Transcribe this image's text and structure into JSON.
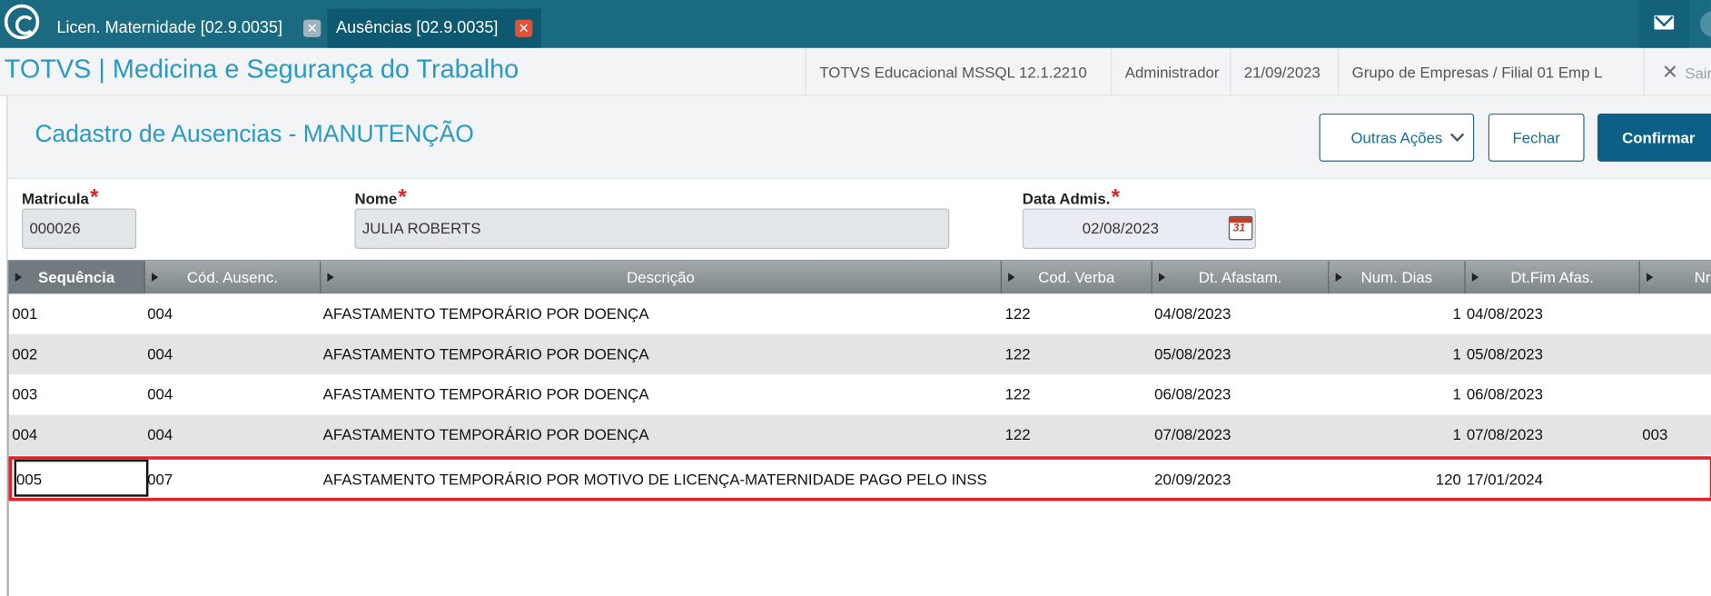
{
  "tabs": [
    {
      "label": "Licen. Maternidade [02.9.0035]",
      "close": "✕"
    },
    {
      "label": "Ausências [02.9.0035]",
      "close": "✕"
    }
  ],
  "header": {
    "title": "TOTVS | Medicina e Segurança do Trabalho",
    "environment": "TOTVS Educacional MSSQL 12.1.2210",
    "user": "Administrador",
    "date": "21/09/2023",
    "company": "Grupo de Empresas / Filial 01 Emp L",
    "exit_label": "Sair",
    "exit_icon": "✕"
  },
  "page": {
    "title": "Cadastro de Ausencias - MANUTENÇÃO",
    "buttons": {
      "outras": "Outras Ações",
      "fechar": "Fechar",
      "confirmar": "Confirmar"
    }
  },
  "form": {
    "matricula": {
      "label": "Matricula",
      "value": "000026"
    },
    "nome": {
      "label": "Nome",
      "value": "JULIA ROBERTS"
    },
    "data_admis": {
      "label": "Data Admis.",
      "value": "02/08/2023"
    },
    "required_mark": "*",
    "calendar_text": "31"
  },
  "grid": {
    "columns": [
      "Sequência",
      "Cód. Ausenc.",
      "Descrição",
      "Cod. Verba",
      "Dt. Afastam.",
      "Num. Dias",
      "Dt.Fim Afas.",
      "Nr.S"
    ],
    "rows": [
      [
        "001",
        "004",
        "AFASTAMENTO TEMPORÁRIO POR DOENÇA",
        "122",
        "04/08/2023",
        "1",
        "04/08/2023",
        ""
      ],
      [
        "002",
        "004",
        "AFASTAMENTO TEMPORÁRIO POR DOENÇA",
        "122",
        "05/08/2023",
        "1",
        "05/08/2023",
        ""
      ],
      [
        "003",
        "004",
        "AFASTAMENTO TEMPORÁRIO POR DOENÇA",
        "122",
        "06/08/2023",
        "1",
        "06/08/2023",
        ""
      ],
      [
        "004",
        "004",
        "AFASTAMENTO TEMPORÁRIO POR DOENÇA",
        "122",
        "07/08/2023",
        "1",
        "07/08/2023",
        "003"
      ],
      [
        "005",
        "007",
        "AFASTAMENTO TEMPORÁRIO POR MOTIVO DE LICENÇA-MATERNIDADE PAGO PELO INSS",
        "",
        "20/09/2023",
        "120",
        "17/01/2024",
        ""
      ]
    ]
  },
  "colors": {
    "topbar": "#1a6a82",
    "accent": "#2a9ac4",
    "primary_button": "#0c5f86",
    "highlight_border": "#e0222a"
  }
}
